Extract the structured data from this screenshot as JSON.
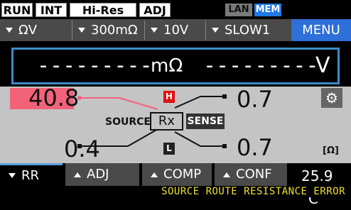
{
  "status_bar": {
    "badges": [
      "RUN",
      "INT",
      "Hi-Res",
      "ADJ"
    ],
    "lan": "LAN",
    "mem": "MEM"
  },
  "range_row": {
    "items": [
      "ΩV",
      "300mΩ",
      "10V",
      "SLOW1"
    ],
    "menu": "MENU"
  },
  "measurement": {
    "resistance": "---------",
    "resistance_unit": "mΩ",
    "voltage": "---------",
    "voltage_unit": "V"
  },
  "panel": {
    "source_high": "40.8",
    "source_low": "0.4",
    "sense_high": "0.7",
    "sense_low": "0.7",
    "h_label": "H",
    "l_label": "L",
    "source_label": "SOURCE",
    "rx_label": "Rx",
    "sense_label": "SENSE",
    "unit": "[Ω]"
  },
  "tabs": [
    "RR",
    "ADJ",
    "COMP",
    "CONF"
  ],
  "temperature": "25.9 °C",
  "error": "SOURCE ROUTE RESISTANCE ERROR",
  "colors": {
    "menu": "#2f6fd8",
    "highlight": "#f2637a",
    "error": "#f0e030",
    "frame": "#3c8cc8"
  }
}
